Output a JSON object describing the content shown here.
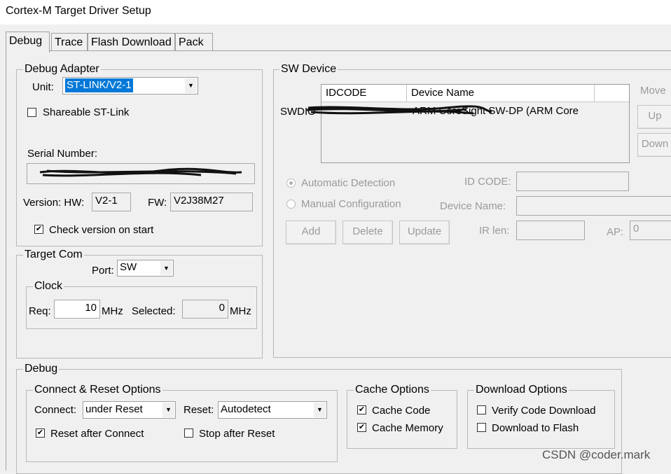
{
  "window": {
    "title": "Cortex-M Target Driver Setup"
  },
  "tabs": [
    {
      "label": "Debug"
    },
    {
      "label": "Trace"
    },
    {
      "label": "Flash Download"
    },
    {
      "label": "Pack"
    }
  ],
  "debug_adapter": {
    "legend": "Debug Adapter",
    "unit_label": "Unit:",
    "unit_value": "ST-LINK/V2-1",
    "shareable_label": "Shareable ST-Link",
    "shareable_checked": false,
    "serial_label": "Serial Number:",
    "version_label": "Version: HW:",
    "hw_value": "V2-1",
    "fw_label": "FW:",
    "fw_value": "V2J38M27",
    "check_version_label": "Check version on start",
    "check_version_checked": true
  },
  "target_com": {
    "legend": "Target Com",
    "port_label": "Port:",
    "port_value": "SW",
    "clock_legend": "Clock",
    "req_label": "Req:",
    "req_value": "10",
    "req_unit": "MHz",
    "selected_label": "Selected:",
    "selected_value": "0",
    "selected_unit": "MHz"
  },
  "sw_device": {
    "legend": "SW Device",
    "row_label": "SWDIO",
    "col_idcode": "IDCODE",
    "col_device_name": "Device Name",
    "row_device_name": "ARM CoreSight SW-DP (ARM Core",
    "move_label": "Move",
    "up_label": "Up",
    "down_label": "Down",
    "auto_detection_label": "Automatic Detection",
    "manual_config_label": "Manual Configuration",
    "id_code_label": "ID CODE:",
    "device_name_label": "Device Name:",
    "ir_len_label": "IR len:",
    "ap_label": "AP:",
    "ap_value": "0",
    "add_label": "Add",
    "delete_label": "Delete",
    "update_label": "Update"
  },
  "debug": {
    "legend": "Debug",
    "connect_reset": {
      "legend": "Connect & Reset Options",
      "connect_label": "Connect:",
      "connect_value": "under Reset",
      "reset_label": "Reset:",
      "reset_value": "Autodetect",
      "reset_after_connect_label": "Reset after Connect",
      "reset_after_connect_checked": true,
      "stop_after_reset_label": "Stop after Reset",
      "stop_after_reset_checked": false
    },
    "cache": {
      "legend": "Cache Options",
      "cache_code_label": "Cache Code",
      "cache_code_checked": true,
      "cache_memory_label": "Cache Memory",
      "cache_memory_checked": true
    },
    "download": {
      "legend": "Download Options",
      "verify_label": "Verify Code Download",
      "verify_checked": false,
      "download_flash_label": "Download to Flash",
      "download_flash_checked": false
    }
  },
  "watermark": "CSDN @coder.mark"
}
